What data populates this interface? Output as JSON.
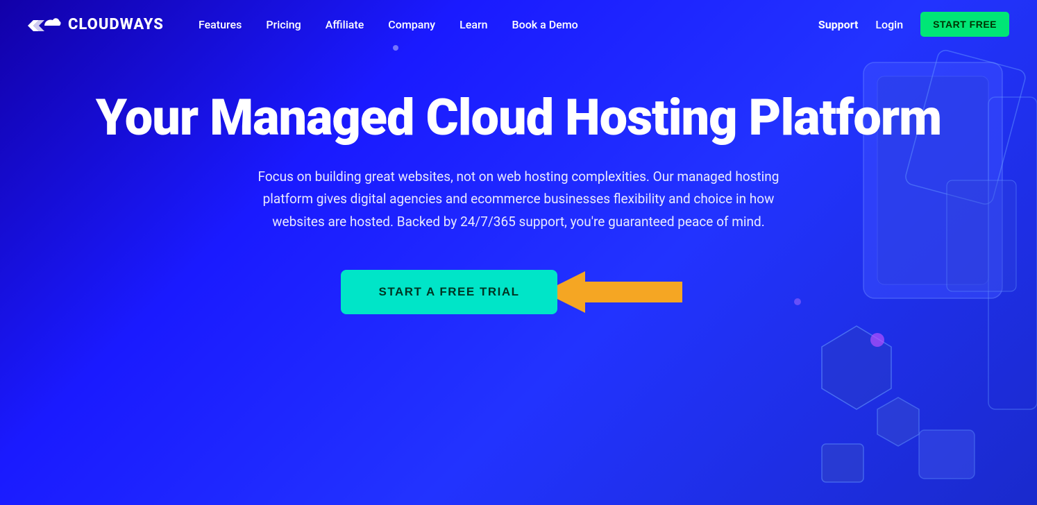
{
  "brand": {
    "name": "CLOUDWAYS",
    "logo_alt": "Cloudways Logo"
  },
  "navbar": {
    "links": [
      {
        "label": "Features",
        "id": "features"
      },
      {
        "label": "Pricing",
        "id": "pricing"
      },
      {
        "label": "Affiliate",
        "id": "affiliate"
      },
      {
        "label": "Company",
        "id": "company"
      },
      {
        "label": "Learn",
        "id": "learn"
      },
      {
        "label": "Book a Demo",
        "id": "book-demo"
      }
    ],
    "support_label": "Support",
    "login_label": "Login",
    "start_free_label": "START FREE"
  },
  "hero": {
    "title": "Your Managed Cloud Hosting Platform",
    "subtitle": "Focus on building great websites, not on web hosting complexities. Our managed hosting platform gives digital agencies and ecommerce businesses flexibility and choice in how websites are hosted. Backed by 24/7/365 support, you're guaranteed peace of mind.",
    "cta_label": "START A FREE TRIAL"
  },
  "colors": {
    "accent_green": "#00e5c8",
    "nav_green": "#00e676",
    "arrow_orange": "#f5a623",
    "bg_dark": "#1200a8",
    "bg_blue": "#2233ff"
  }
}
